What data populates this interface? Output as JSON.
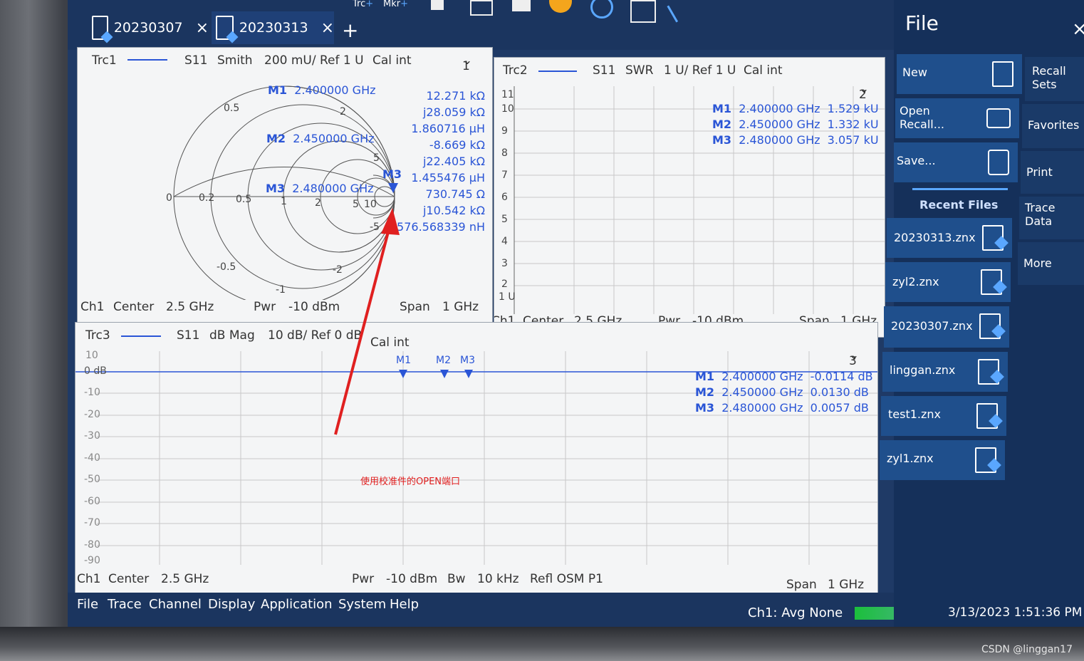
{
  "toolbar": {
    "trc_label": "Trc",
    "mkr_label": "Mkr"
  },
  "tabs": [
    {
      "label": "20230307"
    },
    {
      "label": "20230313"
    }
  ],
  "tab_close": "×",
  "tab_add": "+",
  "trc1": {
    "name": "Trc1",
    "param": "S11",
    "format": "Smith",
    "scale": "200 mU/ Ref 1 U",
    "cal": "Cal int",
    "num": "1",
    "smith_labels": [
      "0.5",
      "2",
      "5",
      "0",
      "0.2",
      "0.5",
      "1",
      "2",
      "5",
      "10",
      "-0.5",
      "-2",
      "-1",
      "-5"
    ],
    "markers": [
      {
        "name": "M1",
        "freq": "2.400000 GHz"
      },
      {
        "name": "M2",
        "freq": "2.450000 GHz"
      },
      {
        "name": "M3",
        "freq": "2.480000 GHz"
      }
    ],
    "readouts": [
      "12.271 kΩ",
      "j28.059 kΩ",
      "1.860716 µH",
      "-8.669 kΩ",
      "j22.405 kΩ",
      "1.455476 µH",
      "730.745 Ω",
      "j10.542 kΩ",
      "576.568339 nH"
    ],
    "m3_tag": "M3",
    "footer": {
      "ch": "Ch1",
      "center": "Center",
      "center_val": "2.5 GHz",
      "pwr": "Pwr",
      "pwr_val": "-10 dBm",
      "span": "Span",
      "span_val": "1 GHz"
    }
  },
  "trc2": {
    "name": "Trc2",
    "param": "S11",
    "format": "SWR",
    "scale": "1 U/ Ref 1 U",
    "cal": "Cal int",
    "num": "2",
    "yticks": [
      "11",
      "10",
      "9",
      "8",
      "7",
      "6",
      "5",
      "4",
      "3",
      "2",
      "1 U"
    ],
    "markers": [
      {
        "name": "M1",
        "freq": "2.400000 GHz",
        "value": "1.529 kU"
      },
      {
        "name": "M2",
        "freq": "2.450000 GHz",
        "value": "1.332 kU"
      },
      {
        "name": "M3",
        "freq": "2.480000 GHz",
        "value": "3.057 kU"
      }
    ],
    "footer": {
      "ch": "Ch1",
      "center": "Center",
      "center_val": "2.5 GHz",
      "pwr": "Pwr",
      "pwr_val": "-10 dBm",
      "span": "Span",
      "span_val": "1 GHz"
    }
  },
  "trc3": {
    "name": "Trc3",
    "param": "S11",
    "format": "dB Mag",
    "scale": "10 dB/ Ref 0 dB",
    "cal": "Cal int",
    "num": "3",
    "yticks": [
      "10",
      "0 dB",
      "-10",
      "-20",
      "-30",
      "-40",
      "-50",
      "-60",
      "-70",
      "-80",
      "-90"
    ],
    "marker_flags": [
      "M1",
      "M2",
      "M3"
    ],
    "markers": [
      {
        "name": "M1",
        "freq": "2.400000 GHz",
        "value": "-0.0114 dB"
      },
      {
        "name": "M2",
        "freq": "2.450000 GHz",
        "value": "0.0130 dB"
      },
      {
        "name": "M3",
        "freq": "2.480000 GHz",
        "value": "0.0057 dB"
      }
    ],
    "footer": {
      "ch": "Ch1",
      "center": "Center",
      "center_val": "2.5 GHz",
      "pwr": "Pwr",
      "pwr_val": "-10 dBm",
      "bw": "Bw",
      "bw_val": "10 kHz",
      "refl": "Refl OSM P1",
      "span": "Span",
      "span_val": "1 GHz"
    }
  },
  "annotation": "使用校准件的OPEN端口",
  "menu": [
    "File",
    "Trace",
    "Channel",
    "Display",
    "Application",
    "System",
    "Help"
  ],
  "status": {
    "avg": "Ch1: Avg None",
    "datetime": "3/13/2023 1:51:36 PM"
  },
  "sidepanel": {
    "title": "File",
    "close": "×",
    "buttons": [
      "New",
      "Open Recall...",
      "Save..."
    ],
    "right_buttons": [
      "Recall Sets",
      "Favorites",
      "Print",
      "Trace Data",
      "More"
    ],
    "recent_title": "Recent Files",
    "recent": [
      "20230313.znx",
      "zyl2.znx",
      "20230307.znx",
      "linggan.znx",
      "test1.znx",
      "zyl1.znx"
    ]
  },
  "watermark": "CSDN @linggan17",
  "colors": {
    "trace": "#2a55d6",
    "accent": "#1f4f8c",
    "annotation": "#e02020"
  }
}
